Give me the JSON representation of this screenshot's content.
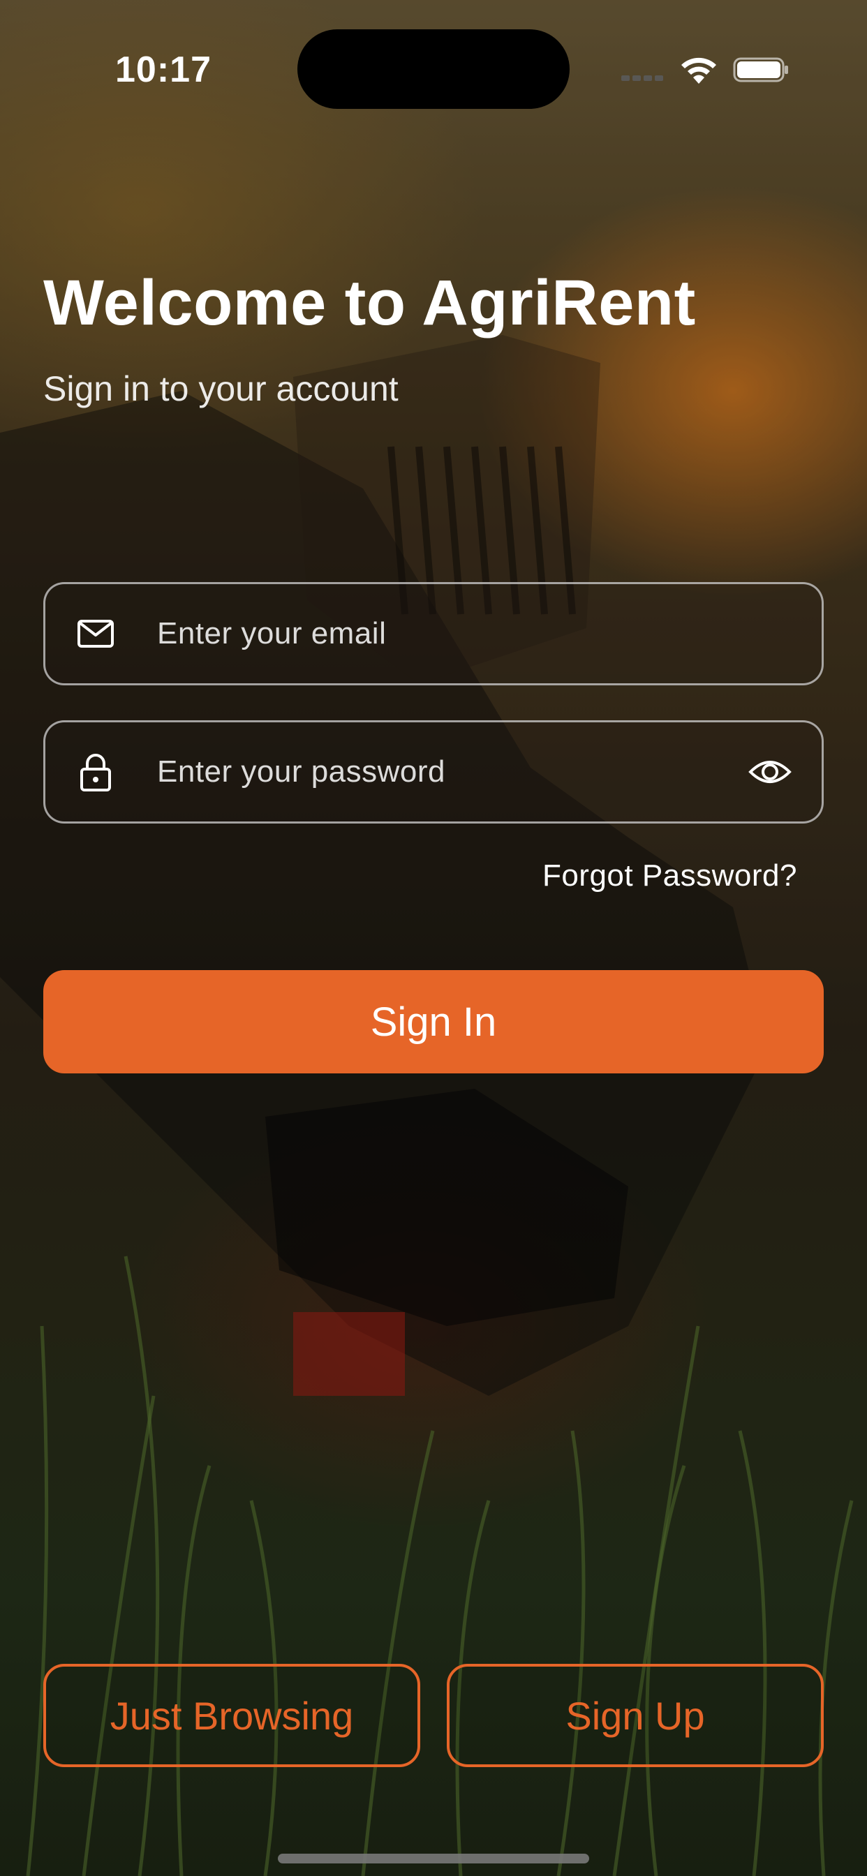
{
  "status_bar": {
    "time": "10:17",
    "icons": [
      "cellular-signal-icon",
      "wifi-icon",
      "battery-icon"
    ]
  },
  "header": {
    "title": "Welcome to AgriRent",
    "subtitle": "Sign in to your account"
  },
  "form": {
    "email": {
      "placeholder": "Enter your email",
      "icon": "mail-icon"
    },
    "password": {
      "placeholder": "Enter your password",
      "icon": "lock-icon",
      "toggle_icon": "eye-icon"
    },
    "forgot_label": "Forgot Password?",
    "signin_label": "Sign In"
  },
  "footer": {
    "browse_label": "Just Browsing",
    "signup_label": "Sign Up"
  },
  "colors": {
    "accent": "#e66528",
    "text": "#ffffff",
    "field_border": "#d2d2d2"
  }
}
